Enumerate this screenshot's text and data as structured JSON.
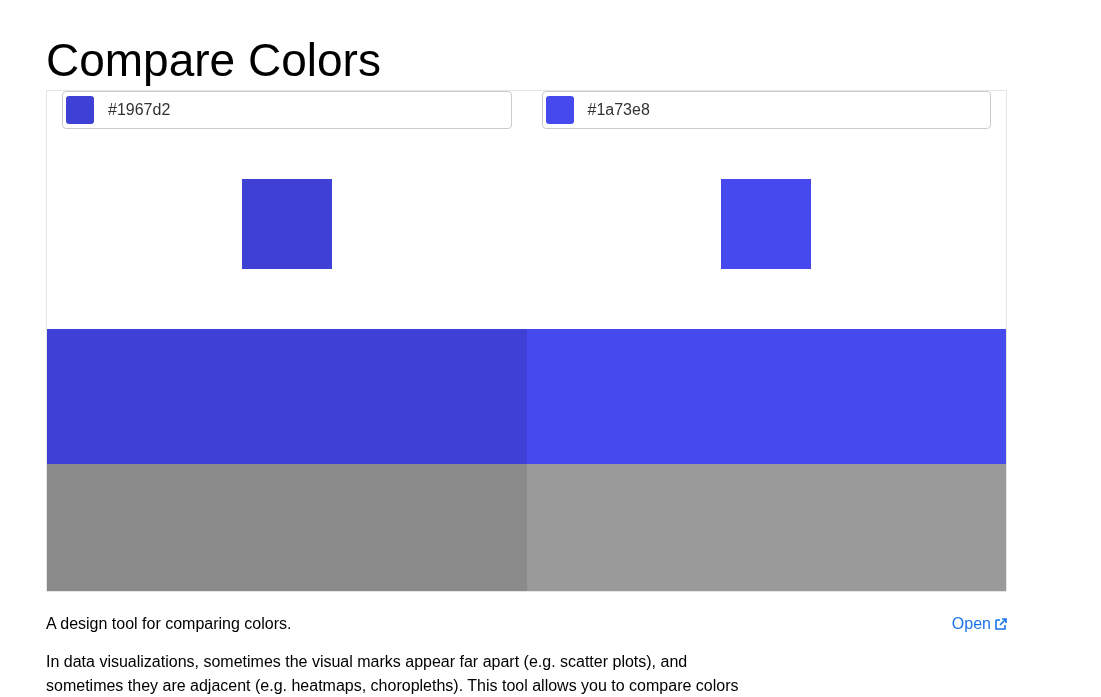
{
  "title": "Compare Colors",
  "colors": [
    {
      "value": "#1967d2",
      "color": "#3f40d6"
    },
    {
      "value": "#1a73e8",
      "color": "#464aee"
    }
  ],
  "description": "A design tool for comparing colors.",
  "open_link": "Open",
  "paragraph": "In data visualizations, sometimes the visual marks appear far apart (e.g. scatter plots), and sometimes they are adjacent (e.g. heatmaps, choropleths). This tool allows you to compare colors"
}
